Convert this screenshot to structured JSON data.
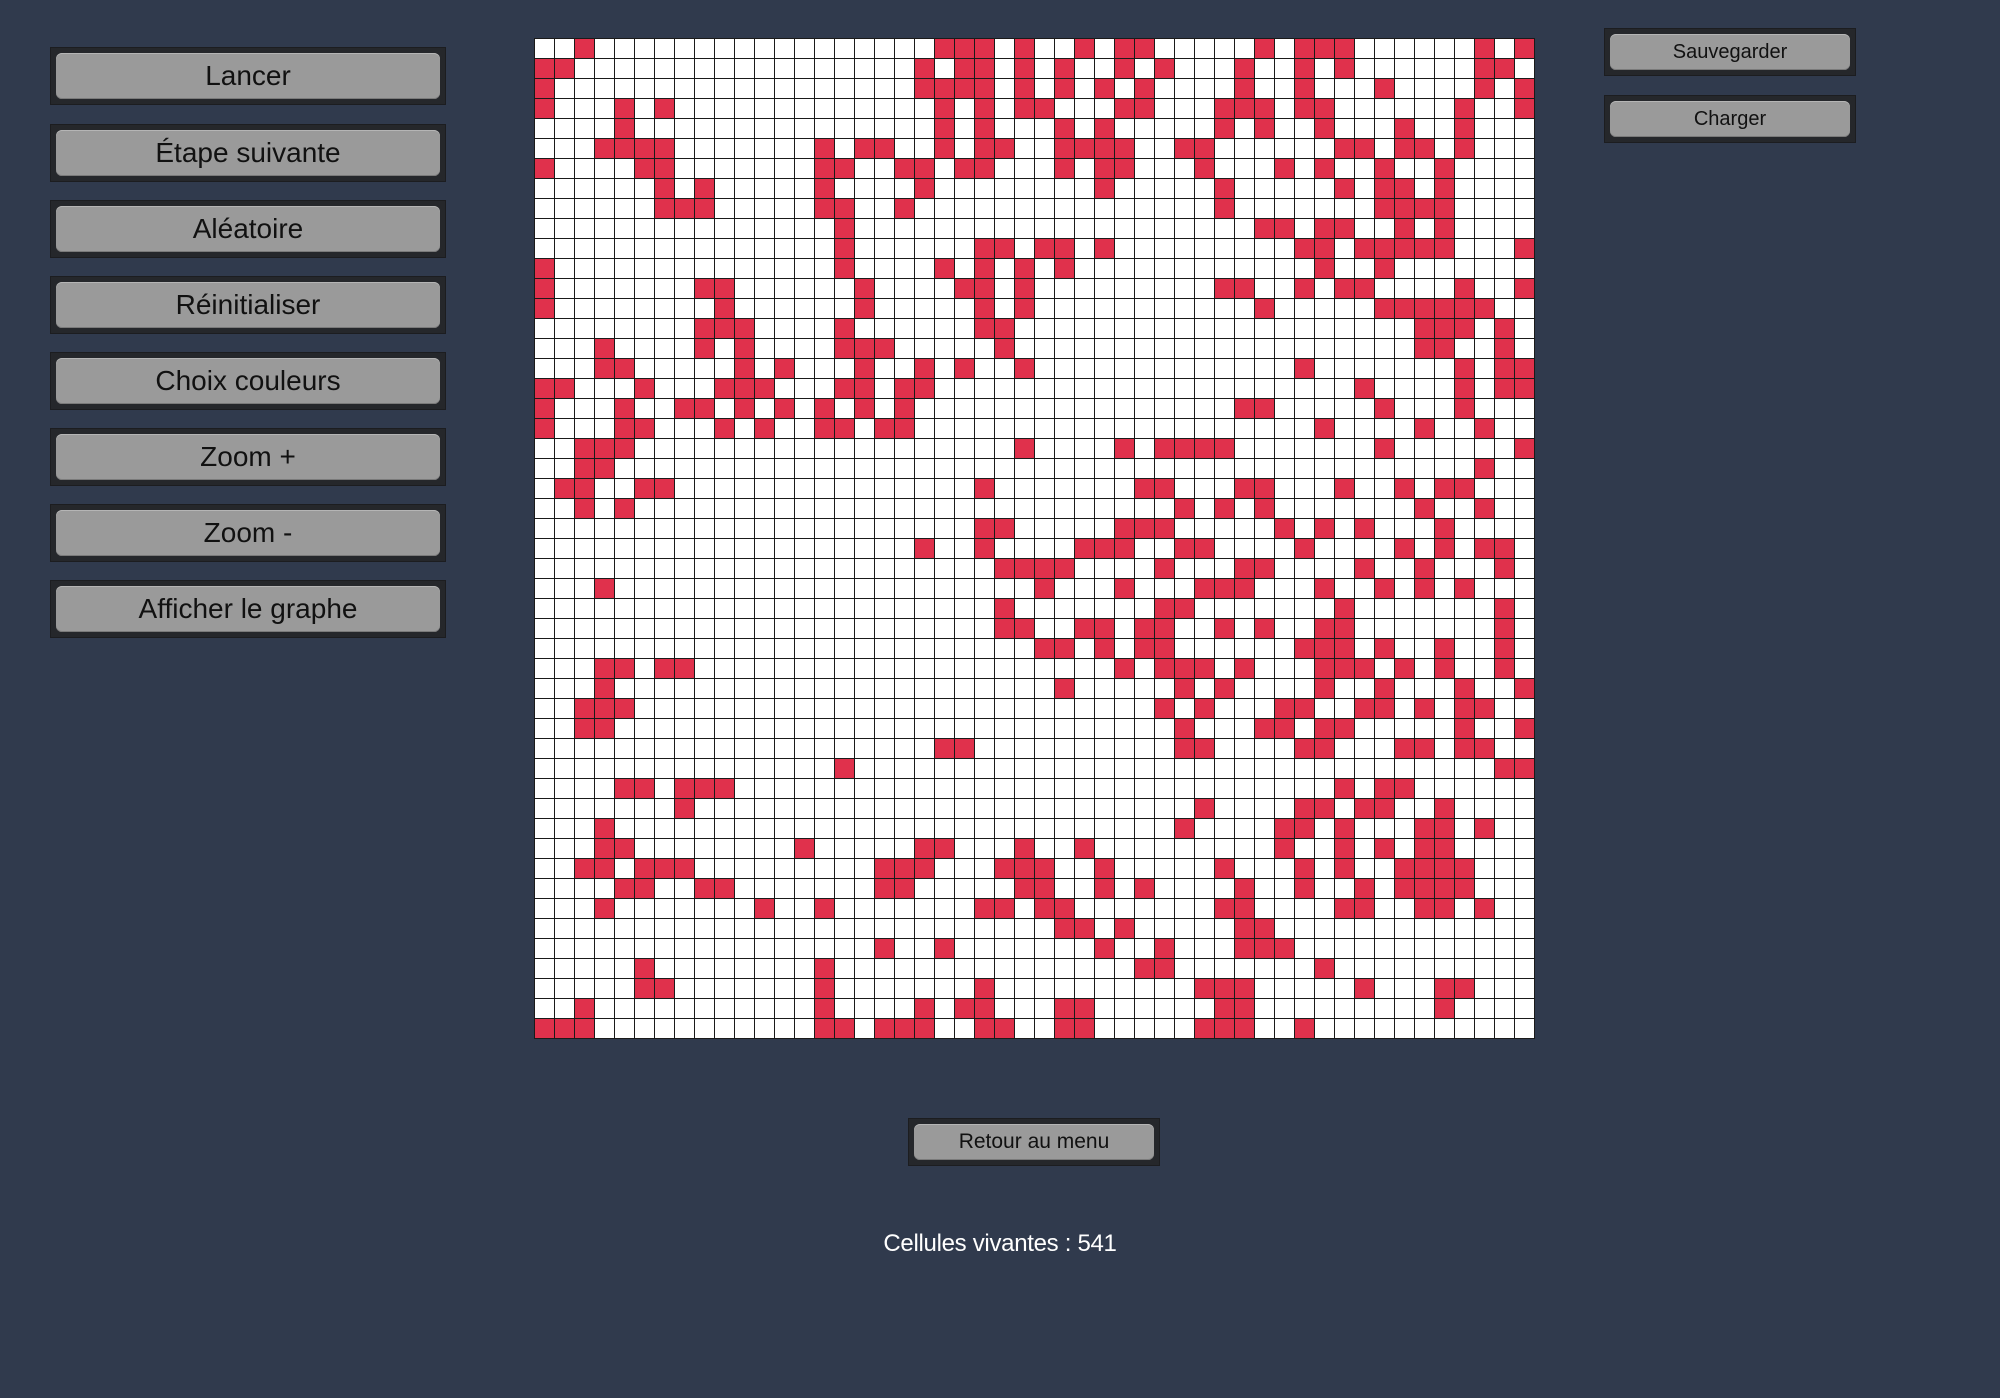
{
  "controls": {
    "buttons": [
      {
        "name": "lancer-button",
        "label": "Lancer"
      },
      {
        "name": "etape-suivante-button",
        "label": "Étape suivante"
      },
      {
        "name": "aleatoire-button",
        "label": "Aléatoire"
      },
      {
        "name": "reinitialiser-button",
        "label": "Réinitialiser"
      },
      {
        "name": "choix-couleurs-button",
        "label": "Choix couleurs"
      },
      {
        "name": "zoom-in-button",
        "label": "Zoom +"
      },
      {
        "name": "zoom-out-button",
        "label": "Zoom -"
      },
      {
        "name": "afficher-graphe-button",
        "label": "Afficher le graphe"
      }
    ]
  },
  "file": {
    "save_label": "Sauvegarder",
    "load_label": "Charger"
  },
  "menu": {
    "back_label": "Retour au menu"
  },
  "status": {
    "live_cells": "Cellules vivantes : 541"
  },
  "colors": {
    "alive": "#e0314c",
    "dead": "#ffffff",
    "background": "#303a4d"
  },
  "grid": {
    "columns": 50,
    "rows": 50,
    "alive_cells": [
      "..F.................FFF.F..F.FF.....F.FFF......F.F",
      "FF.................F.FF.F.F..F.F...F..F.F......FF",
      "F..................FFFF.F.F.F.F....F..F...F....F.F",
      "F...F.F.............F.F.FF...FF...FFF.FF......F..F",
      "....F...............F.F...F.F.....F.F..F...F..F..",
      "...FFFF.......F.FF..F.FF..FFFF..FF......FF.FF.F...FF",
      "F....FF.......FF..FF.FF...F.FF...F...F.F..F..F...",
      "......F.F.....F....F........F.....F.....F.FF.F...",
      "......FFF.....FF..F...............F.......FFFF....",
      "...............F....................FF.FF..F.F....",
      "...............F......FF.FF.F.........FF.FFFFF...F",
      "F..............F....F.F.F.F............F..F......",
      "F.......FF......F....FF.F.........FF..F.FF....F..FF",
      "F........F......F.....F.F...........F.....FFFFFF...",
      "........FFF....F......FF....................FFF.F.",
      "...F....F.F....FFF.....F....................FF..F.",
      "...FF.....F.F...F..F.F..F.............F.......F.FF",
      "FF...F...FFF...FF.FF.....................F....F.FFF",
      "F...F..FF.F.F.F.F.F................FF.....F...F...",
      "F...FF...F.F..FF.FF....................F....F..F..",
      "..FFF...................F....F.FFFF.......F......FFF",
      "..FF...........................................F.",
      ".FF..FF...............F.......FF...FF...F..F.FF..",
      "..F.F...........................F.F.F.......F..F.",
      "......................FF.....FFF.....F.F.F...F...",
      "...................F..F....FFF..FF....F....F.F.FF.",
      ".......................FFFF....F...FF....F..F...F",
      "...F.....................F...F...FFF...F..F.F.F..",
      ".......................F.......FF.......F.......F",
      ".......................FF..FF.FF..F.F..FF.......F",
      ".........................FF.F.FF......FFF.F..F..F.",
      "...FF.FF.....................F.FFF.F...FFF.F.F..F.",
      "...F......................F.....F.F....F..F...F..F",
      "..FFF..........................F.F...FF..FF.F.FF..",
      "..FF............................F...FF.FF.....F..F.",
      "....................FF..........FF....FF...FF.FF.",
      "...............F................................FF.",
      "....FF.FFF..............................F.FF......",
      ".......F.........................F....FF.FF..F...",
      "...F............................F....FF.F...FF.F..",
      "...FF........F.....FF...F..F.........F..F.F.FF...",
      "..FF.FFF.........FFF...FFF..F.....F...F.F..FFFF.",
      "....FF..FF.......FF.....FF..F.F....F..F..F.FFFF..",
      "...F.......F..F.......FF.FF.......FF....FF..FF.F.",
      "..........................FF.F.....FF.............",
      ".................F..F.......F..F...FFF............",
      ".....F........F...............FF.......F.........",
      ".....FF.......F.......F..........FFF.....F...FF..",
      "..F...........F....F.FF...FF......FF.........F...",
      "FFF...........FF.FFF..FF..FF.....FFF..F..........."
    ]
  }
}
